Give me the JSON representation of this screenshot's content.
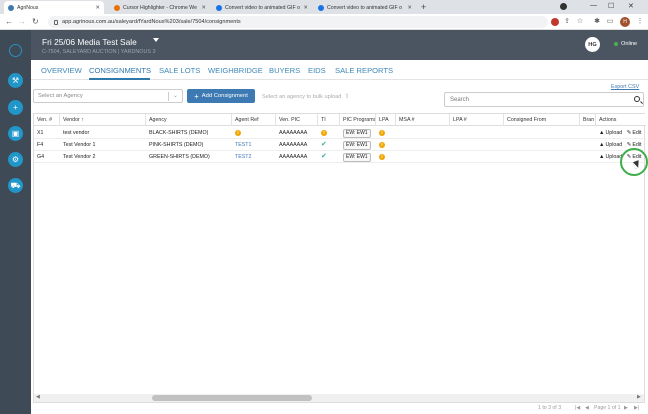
{
  "browser": {
    "tabs": [
      {
        "title": "AgriNous",
        "active": true,
        "favicon_color": "#3d7ab3"
      },
      {
        "title": "Cursor Highlighter - Chrome We",
        "active": false,
        "favicon_color": "#e8710a"
      },
      {
        "title": "Convert video to animated GIF o",
        "active": false,
        "favicon_color": "#1a73e8"
      },
      {
        "title": "Convert video to animated GIF o",
        "active": false,
        "favicon_color": "#1a73e8"
      }
    ],
    "url": "app.agrinous.com.au/saleyard/fYardNous%203/sale/7504/consignments",
    "profile_initial": "H"
  },
  "header": {
    "sale_title": "Fri 25/06 Media Test Sale",
    "sale_subtitle": "C-7504, SALEYARD AUCTION | YARDNOUS 3",
    "user_initials": "HG",
    "status": "Online"
  },
  "nav": {
    "tabs": [
      "OVERVIEW",
      "CONSIGNMENTS",
      "SALE LOTS",
      "WEIGHBRIDGE",
      "BUYERS",
      "EIDS",
      "SALE REPORTS"
    ],
    "active": "CONSIGNMENTS"
  },
  "toolbar": {
    "agency_placeholder": "Select an Agency",
    "add_label": "Add Consignment",
    "bulk_upload_label": "Select an agency to bulk upload",
    "export_label": "Export CSV",
    "search_placeholder": "Search"
  },
  "table": {
    "columns": [
      "Ven. #",
      "Vendor",
      "Agency",
      "Agent Ref",
      "Ven. PIC",
      "TI",
      "PIC Programs",
      "LPA",
      "MSA #",
      "LPA #",
      "Consigned From",
      "Bran",
      "Actions"
    ],
    "sort_column": "Vendor",
    "rows": [
      {
        "ven": "X1",
        "vendor": "test vendor",
        "agency": "BLACK-SHIRTS (DEMO)",
        "agent_ref": "",
        "agent_ref_warn": true,
        "pic": "AAAAAAAA",
        "ti": "warn",
        "program": "EW: EW1",
        "lpa": "warn",
        "upload": "Upload",
        "edit": "Edit"
      },
      {
        "ven": "F4",
        "vendor": "Test Vendor 1",
        "agency": "PINK-SHIRTS (DEMO)",
        "agent_ref": "TEST1",
        "agent_ref_warn": false,
        "pic": "AAAAAAAA",
        "ti": "tick",
        "program": "EW: EW1",
        "lpa": "warn",
        "upload": "Upload",
        "edit": "Edit"
      },
      {
        "ven": "G4",
        "vendor": "Test Vendor 2",
        "agency": "GREEN-SHIRTS (DEMO)",
        "agent_ref": "TEST2",
        "agent_ref_warn": false,
        "pic": "AAAAAAAA",
        "ti": "tick",
        "program": "EW: EW1",
        "lpa": "warn",
        "upload": "Upload",
        "edit": "Edit"
      }
    ]
  },
  "pagination": {
    "range": "1 to 3 of 3",
    "page": "Page 1 of 1"
  },
  "colors": {
    "rail": "#3f4a57",
    "header": "#4a5561",
    "accent": "#3d7ab3",
    "warn": "#f0a500",
    "tick": "#3fb0a0"
  }
}
